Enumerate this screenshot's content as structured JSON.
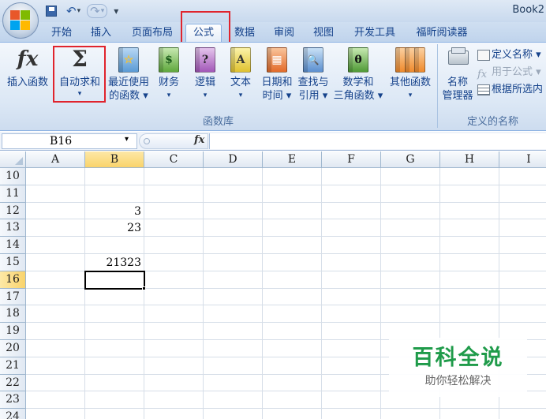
{
  "window": {
    "title": "Book2"
  },
  "qat": {
    "save": "💾",
    "undo": "↶",
    "redo": "↷",
    "dropdown": "▾",
    "customize": "₹"
  },
  "tabs": [
    {
      "label": "开始"
    },
    {
      "label": "插入"
    },
    {
      "label": "页面布局"
    },
    {
      "label": "公式"
    },
    {
      "label": "数据"
    },
    {
      "label": "审阅"
    },
    {
      "label": "视图"
    },
    {
      "label": "开发工具"
    },
    {
      "label": "福昕阅读器"
    }
  ],
  "ribbon": {
    "groups": [
      {
        "label": "函数库"
      },
      {
        "label": "定义的名称"
      }
    ],
    "buttons": {
      "insert_function": {
        "label": "插入函数",
        "icon": "fx"
      },
      "autosum": {
        "label": "自动求和",
        "icon": "Σ",
        "arrow": "▾"
      },
      "recent": {
        "line1": "最近使用",
        "line2": "的函数 ▾",
        "icon": "☆"
      },
      "financial": {
        "label": "财务",
        "arrow": "▾",
        "icon": "$"
      },
      "logical": {
        "label": "逻辑",
        "arrow": "▾",
        "icon": "?"
      },
      "text": {
        "label": "文本",
        "arrow": "▾",
        "icon": "A"
      },
      "datetime": {
        "line1": "日期和",
        "line2": "时间 ▾",
        "icon": "▦"
      },
      "lookup": {
        "line1": "查找与",
        "line2": "引用 ▾",
        "icon": "🔍"
      },
      "math": {
        "line1": "数学和",
        "line2": "三角函数 ▾",
        "icon": "θ"
      },
      "more": {
        "line1": "其他函数",
        "line2": "▾",
        "icon": "≡"
      },
      "name_manager": {
        "line1": "名称",
        "line2": "管理器"
      },
      "define_name": {
        "label": "定义名称 ▾"
      },
      "use_in_formula": {
        "label": "用于公式 ▾"
      },
      "create_from_selection": {
        "label": "根据所选内"
      }
    }
  },
  "formula_bar": {
    "name_box": "B16",
    "name_arrow": "▾",
    "fx": "fx",
    "value": ""
  },
  "grid": {
    "columns": [
      "A",
      "B",
      "C",
      "D",
      "E",
      "F",
      "G",
      "H",
      "I"
    ],
    "rows": [
      "10",
      "11",
      "12",
      "13",
      "14",
      "15",
      "16",
      "17",
      "18",
      "19",
      "20",
      "21",
      "22",
      "23",
      "24"
    ],
    "cells": {
      "B12": "3",
      "B13": "23",
      "B15": "21323"
    },
    "selected_column": "B",
    "selected_row": "16"
  },
  "watermark": {
    "title": "百科全说",
    "subtitle": "助你轻松解决"
  },
  "colors": {
    "highlight": "#e0242d",
    "tab_text": "#15428b",
    "watermark": "#1f9b4a"
  }
}
